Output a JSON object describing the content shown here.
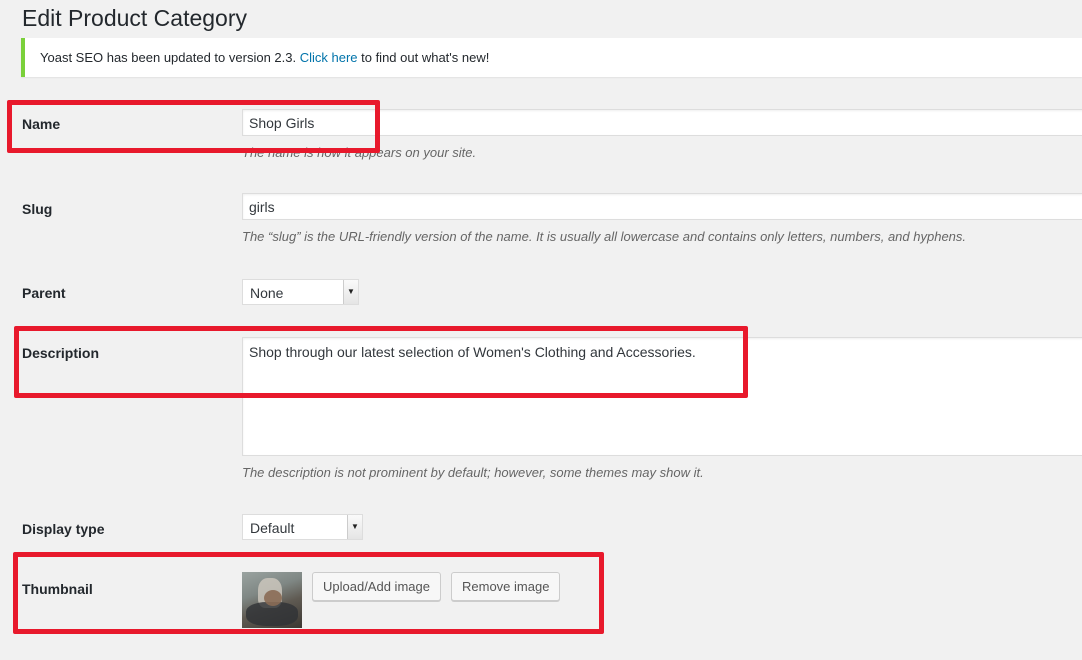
{
  "page": {
    "title": "Edit Product Category"
  },
  "notice": {
    "text_before": "Yoast SEO has been updated to version 2.3. ",
    "link_text": "Click here",
    "text_after": " to find out what's new!",
    "accent_color": "#7ad03a"
  },
  "fields": {
    "name": {
      "label": "Name",
      "value": "Shop Girls",
      "help": "The name is how it appears on your site."
    },
    "slug": {
      "label": "Slug",
      "value": "girls",
      "help": "The “slug” is the URL-friendly version of the name. It is usually all lowercase and contains only letters, numbers, and hyphens."
    },
    "parent": {
      "label": "Parent",
      "selected": "None"
    },
    "description": {
      "label": "Description",
      "value": "Shop through our latest selection of Women's Clothing and Accessories.",
      "help": "The description is not prominent by default; however, some themes may show it."
    },
    "display_type": {
      "label": "Display type",
      "selected": "Default"
    },
    "thumbnail": {
      "label": "Thumbnail",
      "upload_label": "Upload/Add image",
      "remove_label": "Remove image"
    }
  },
  "icons": {
    "select_arrow": "chevron-down-icon"
  },
  "highlight_color": "#e8192c"
}
